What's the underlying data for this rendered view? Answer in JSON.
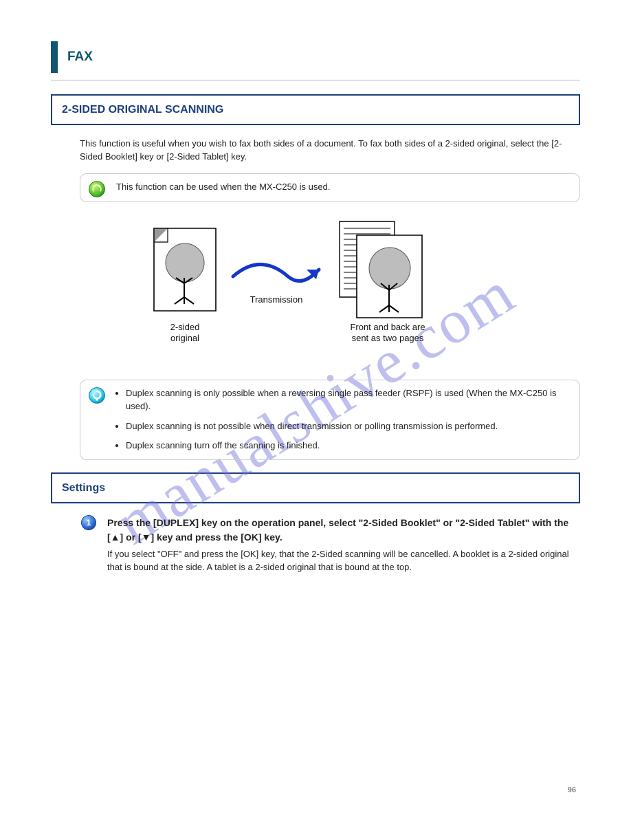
{
  "header": {
    "title": "FAX"
  },
  "section_title": "2-SIDED ORIGINAL SCANNING",
  "intro": "This function is useful when you wish to fax both sides of a document. To fax both sides of a 2-sided original, select the [2-Sided Booklet] key or [2-Sided Tablet] key.",
  "tip": "This function can be used when the MX-C250 is used.",
  "diagram": {
    "arrow_label": "Transmission",
    "left_caption_line1": "2-sided",
    "left_caption_line2": "original",
    "right_caption_line1": "Front and back are",
    "right_caption_line2": "sent as two pages"
  },
  "info_bullets": [
    "Duplex scanning is only possible when a reversing single pass feeder (RSPF) is used (When the MX-C250 is used).",
    "Duplex scanning is not possible when direct transmission or polling transmission is performed.",
    "Duplex scanning turn off the scanning is finished."
  ],
  "settings_section_title": "Settings",
  "step1": {
    "title": "Press the [DUPLEX] key on the operation panel, select \"2-Sided Booklet\" or \"2-Sided Tablet\" with the [▲] or [▼] key and press the [OK] key.",
    "note": "If you select \"OFF\" and press the [OK] key, that the 2-Sided scanning will be cancelled. A booklet is a 2-sided original that is bound at the side. A tablet is a 2-sided original that is bound at the top."
  },
  "watermark": "manualshive.com",
  "page_number": "96"
}
